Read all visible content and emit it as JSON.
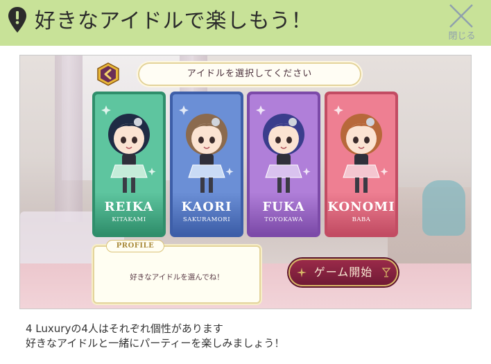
{
  "header": {
    "title": "好きなアイドルで楽しもう！",
    "close_label": "閉じる",
    "colors": {
      "bar": "#c8e298",
      "title_text": "#2b2b2b",
      "close_icon": "#8fa0ad"
    },
    "icons": {
      "pin": "map-pin-exclamation-icon",
      "close": "close-x-icon"
    }
  },
  "game": {
    "banner": "アイドルを選択してください",
    "back_icon": "chevron-left-icon",
    "cards": [
      {
        "name": "REIKA",
        "surname": "KITAKAMI",
        "color": "#5ec59f",
        "dark": "#2f8e6b"
      },
      {
        "name": "KAORI",
        "surname": "SAKURAMORI",
        "color": "#6b8fd6",
        "dark": "#3d5ea8"
      },
      {
        "name": "FUKA",
        "surname": "TOYOKAWA",
        "color": "#b07fd9",
        "dark": "#7c4aa8"
      },
      {
        "name": "KONOMI",
        "surname": "BABA",
        "color": "#ee7f92",
        "dark": "#c24c63"
      }
    ],
    "profile": {
      "tab": "PROFILE",
      "text": "好きなアイドルを選んでね！"
    },
    "start_button": "ゲーム開始"
  },
  "description": {
    "line1": "4 Luxuryの4人はそれぞれ個性があります",
    "line2": "好きなアイドルと一緒にパーティーを楽しみましょう！"
  }
}
